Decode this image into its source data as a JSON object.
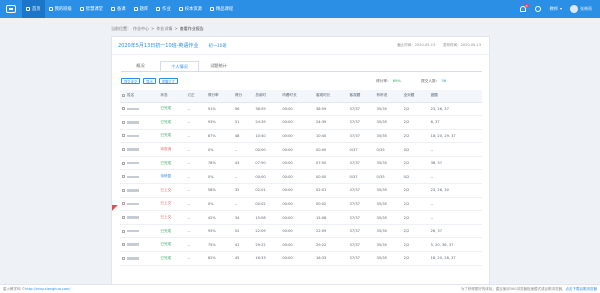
{
  "nav": {
    "items": [
      {
        "label": "首页",
        "active": true
      },
      {
        "label": "我的班级",
        "active": false
      },
      {
        "label": "智慧课堂",
        "active": false
      },
      {
        "label": "备课",
        "active": false
      },
      {
        "label": "题库",
        "active": false
      },
      {
        "label": "作业",
        "active": false
      },
      {
        "label": "校本资源",
        "active": false
      },
      {
        "label": "精品课程",
        "active": false
      }
    ],
    "badge_count": "3",
    "role": "教师",
    "user": "张晓雨"
  },
  "breadcrumb": [
    "当前位置：",
    "作业中心",
    ">",
    "作业详情",
    ">",
    "查看作业报告"
  ],
  "card": {
    "title": "2020年5月13日初一10班-英语作业",
    "class_tag": "初一10班",
    "deadline": "截止时间：2020-05-13",
    "publish": "发布时间：2020-05-13"
  },
  "tabs": [
    "概况",
    "个人情况",
    "试题统计"
  ],
  "actions": [
    "提交未交",
    "导出",
    "提醒订正"
  ],
  "score": {
    "rate_label": "得分率：",
    "rate_value": "69%",
    "count_label": "提交人数：",
    "count_value": "36"
  },
  "table": {
    "columns": [
      "姓名",
      "状态",
      "订正",
      "得分率",
      "得分",
      "总用时",
      "听看时长",
      "客观时长",
      "客观题",
      "有听说",
      "全对题",
      "错题"
    ],
    "rows": [
      [
        "□□",
        "已完成",
        "--",
        "91%",
        "56",
        "38:59",
        "00:00",
        "38:59",
        "37/37",
        "35/35",
        "2/2",
        "23, 26, 37"
      ],
      [
        "□□",
        "已完成",
        "--",
        "93%",
        "51",
        "24:39",
        "00:00",
        "24:39",
        "37/37",
        "35/35",
        "2/2",
        "6, 37"
      ],
      [
        "□□",
        "已完成",
        "--",
        "87%",
        "48",
        "10:40",
        "00:00",
        "10:40",
        "37/37",
        "35/35",
        "2/2",
        "18, 20, 29, 37"
      ],
      [
        "□□",
        "待查询",
        "--",
        "0%",
        "--",
        "00:00",
        "00:00",
        "00:00",
        "0/37",
        "0/35",
        "0/2",
        "--"
      ],
      [
        "□□",
        "已完成",
        "--",
        "78%",
        "43",
        "07:50",
        "00:00",
        "07:50",
        "37/37",
        "35/35",
        "2/2",
        "36, 37"
      ],
      [
        "□□",
        "待修复",
        "--",
        "0%",
        "--",
        "00:00",
        "00:00",
        "00:00",
        "0/37",
        "0/35",
        "0/2",
        "--"
      ],
      [
        "□□",
        "已上交",
        "--",
        "58%",
        "32",
        "02:01",
        "00:00",
        "02:01",
        "37/37",
        "35/35",
        "2/2",
        "23, 26, 30"
      ],
      [
        "□□",
        "已上交",
        "--",
        "0%",
        "--",
        "00:02",
        "00:00",
        "00:02",
        "37/37",
        "35/35",
        "2/2",
        "--"
      ],
      [
        "□□",
        "已上交",
        "--",
        "42%",
        "34",
        "15:08",
        "00:00",
        "15:08",
        "37/37",
        "35/35",
        "2/2",
        "--"
      ],
      [
        "□□",
        "已完成",
        "--",
        "95%",
        "52",
        "22:09",
        "00:00",
        "22:09",
        "37/37",
        "35/35",
        "2/2",
        "26, 37"
      ],
      [
        "□□",
        "已完成",
        "--",
        "75%",
        "41",
        "29:22",
        "00:00",
        "29:22",
        "37/37",
        "35/35",
        "2/2",
        "5, 20, 36, 37"
      ],
      [
        "□□",
        "已完成",
        "--",
        "82%",
        "45",
        "16:33",
        "00:00",
        "16:33",
        "37/37",
        "35/35",
        "2/2",
        "18, 20, 28, 37"
      ]
    ]
  },
  "footer": {
    "left": "星火教学网 ©",
    "link": "http://zhxy.xianghuo.com/",
    "right_prefix": "为了获得更好的体验，建议使用360浏览器极速模式或谷歌浏览器，",
    "right_link": "点击下载谷歌浏览器"
  }
}
